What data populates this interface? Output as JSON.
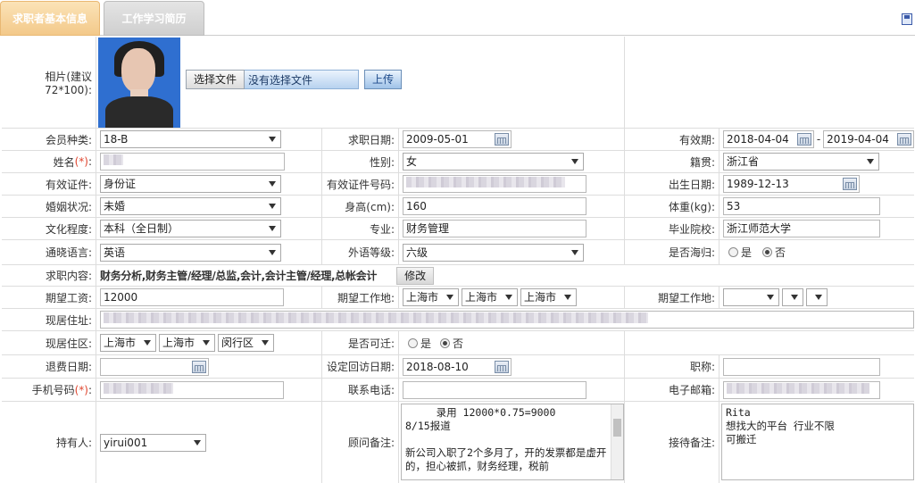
{
  "tabs": [
    {
      "label": "求职者基本信息"
    },
    {
      "label": "工作学习简历"
    }
  ],
  "photo": {
    "label": "相片(建议72*100):",
    "choose_file": "选择文件",
    "no_file": "没有选择文件",
    "upload": "上传"
  },
  "member_type": {
    "label": "会员种类:",
    "value": "18-B"
  },
  "apply_date": {
    "label": "求职日期:",
    "value": "2009-05-01"
  },
  "valid_period": {
    "label": "有效期:",
    "start": "2018-04-04",
    "sep": "-",
    "end": "2019-04-04"
  },
  "name": {
    "label": "姓名",
    "req": "(*)",
    "colon": ":"
  },
  "gender": {
    "label": "性别:",
    "value": "女"
  },
  "native": {
    "label": "籍贯:",
    "value": "浙江省"
  },
  "id_doc": {
    "label": "有效证件:",
    "value": "身份证"
  },
  "id_no": {
    "label": "有效证件号码:"
  },
  "birth": {
    "label": "出生日期:",
    "value": "1989-12-13"
  },
  "marital": {
    "label": "婚姻状况:",
    "value": "未婚"
  },
  "height": {
    "label": "身高(cm):",
    "value": "160"
  },
  "weight": {
    "label": "体重(kg):",
    "value": "53"
  },
  "education": {
    "label": "文化程度:",
    "value": "本科（全日制）"
  },
  "major": {
    "label": "专业:",
    "value": "财务管理"
  },
  "school": {
    "label": "毕业院校:",
    "value": "浙江师范大学"
  },
  "language": {
    "label": "通晓语言:",
    "value": "英语"
  },
  "foreign_level": {
    "label": "外语等级:",
    "value": "六级"
  },
  "overseas": {
    "label": "是否海归:",
    "yes": "是",
    "no": "否"
  },
  "job_content": {
    "label": "求职内容:",
    "value": "财务分析,财务主管/经理/总监,会计,会计主管/经理,总帐会计",
    "edit": "修改"
  },
  "salary": {
    "label": "期望工资:",
    "value": "12000"
  },
  "work_place": {
    "label": "期望工作地:",
    "p1": "上海市",
    "p2": "上海市",
    "p3": "上海市"
  },
  "work_place2": {
    "label": "期望工作地:"
  },
  "address": {
    "label": "现居住址:"
  },
  "district": {
    "label": "现居住区:",
    "p1": "上海市",
    "p2": "上海市",
    "p3": "闵行区"
  },
  "relocate": {
    "label": "是否可迁:",
    "yes": "是",
    "no": "否"
  },
  "refund_date": {
    "label": "退费日期:"
  },
  "callback_date": {
    "label": "设定回访日期:",
    "value": "2018-08-10"
  },
  "title": {
    "label": "职称:"
  },
  "mobile": {
    "label": "手机号码",
    "req": "(*)",
    "colon": ":"
  },
  "phone": {
    "label": "联系电话:"
  },
  "email": {
    "label": "电子邮箱:"
  },
  "holder": {
    "label": "持有人:",
    "value": "yirui001"
  },
  "advisor_note": {
    "label": "顾问备注:",
    "value": "     录用 12000*0.75=9000\n8/15报道\n\n新公司入职了2个多月了，开的发票都是虚开的，担心被抓，财务经理，税前"
  },
  "reception_note": {
    "label": "接待备注:",
    "value": "Rita\n想找大的平台 行业不限\n可搬迁"
  },
  "colors": {
    "tab_active": "#f3c98a",
    "required": "#e0462f",
    "border": "#dddddd"
  }
}
